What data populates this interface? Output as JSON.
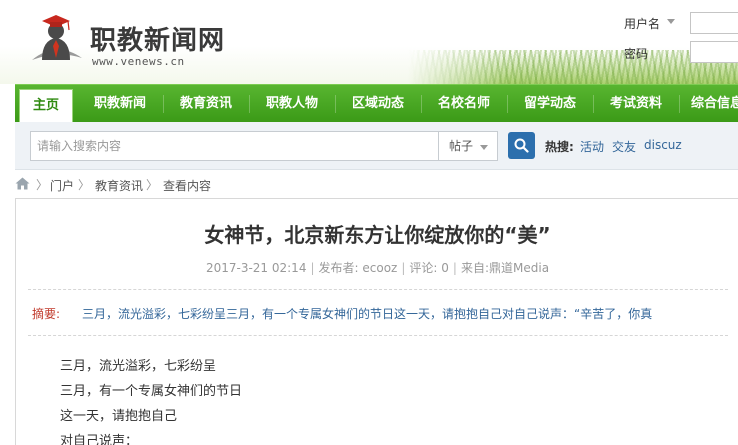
{
  "site": {
    "title": "职教新闻网",
    "url": "www.venews.cn"
  },
  "login": {
    "username_label": "用户名",
    "password_label": "密码"
  },
  "nav": {
    "items": [
      {
        "label": "主页",
        "active": true
      },
      {
        "label": "职教新闻"
      },
      {
        "label": "教育资讯"
      },
      {
        "label": "职教人物"
      },
      {
        "label": "区域动态"
      },
      {
        "label": "名校名师"
      },
      {
        "label": "留学动态"
      },
      {
        "label": "考试资料"
      },
      {
        "label": "综合信息"
      }
    ]
  },
  "search": {
    "placeholder": "请输入搜索内容",
    "scope": "帖子",
    "hot_label": "热搜:",
    "hot_links": [
      "活动",
      "交友",
      "discuz"
    ]
  },
  "breadcrumb": [
    "门户",
    "教育资讯",
    "查看内容"
  ],
  "article": {
    "title": "女神节，北京新东方让你绽放你的“美”",
    "date": "2017-3-21 02:14",
    "author_label": "发布者:",
    "author": "ecooz",
    "comments_label": "评论:",
    "comments": "0",
    "source_label": "来自:",
    "source": "鼎道Media",
    "summary_label": "摘要:",
    "summary": "三月，流光溢彩，七彩纷呈三月，有一个专属女神们的节日这一天，请抱抱自己对自己说声：“辛苦了，你真",
    "body": [
      "三月，流光溢彩，七彩纷呈",
      "三月，有一个专属女神们的节日",
      "这一天，请抱抱自己",
      "对自己说声："
    ]
  },
  "colors": {
    "nav_green": "#3b9a17",
    "link_blue": "#336699",
    "summary_red": "#c0392b",
    "search_button": "#2c6fad"
  }
}
